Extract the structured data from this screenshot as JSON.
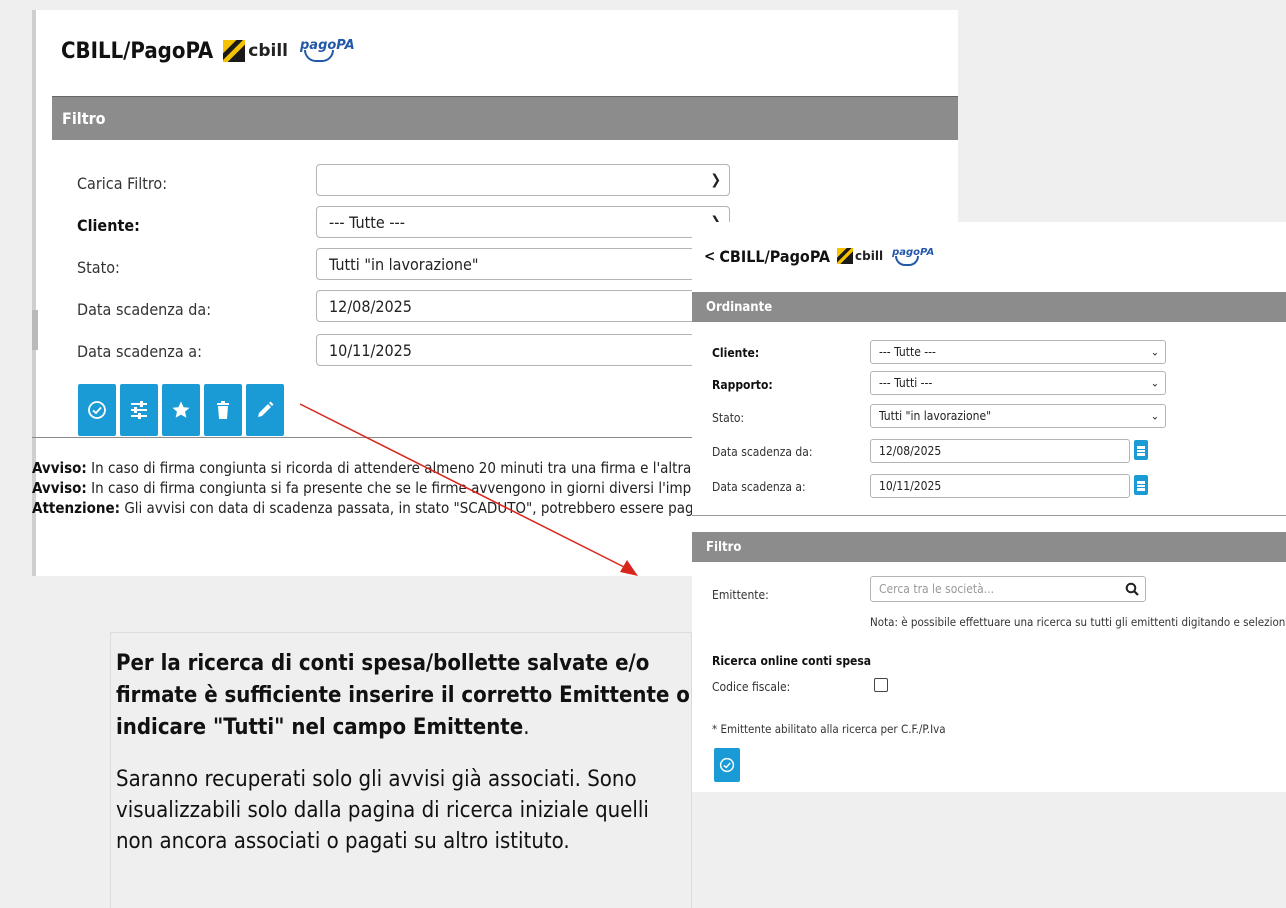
{
  "colors": {
    "accent": "#1b9bd6",
    "section_bar": "#8c8c8c",
    "arrow": "#d9261c"
  },
  "panel1": {
    "title": "CBILL/PagoPA",
    "logo_cbill": "cbill",
    "logo_pagopa": "pagoPA",
    "section_title": "Filtro",
    "fields": {
      "carica_filtro_label": "Carica Filtro:",
      "carica_filtro_value": "",
      "cliente_label": "Cliente:",
      "cliente_value": "--- Tutte ---",
      "stato_label": "Stato:",
      "stato_value": "Tutti \"in lavorazione\"",
      "data_da_label": "Data scadenza da:",
      "data_da_value": "12/08/2025",
      "data_a_label": "Data scadenza a:",
      "data_a_value": "10/11/2025"
    },
    "toolbar_icons": [
      "check-circle-icon",
      "sliders-icon",
      "star-icon",
      "trash-icon",
      "pencil-icon"
    ],
    "notes": [
      {
        "bold": "Avviso:",
        "text": " In caso di firma congiunta si ricorda di attendere almeno 20 minuti tra una firma e l'altra, in"
      },
      {
        "bold": "Avviso:",
        "text": " In caso di firma congiunta si fa presente che se le firme avvengono in giorni diversi l'importo"
      },
      {
        "bold": "Attenzione:",
        "text": " Gli avvisi con data di scadenza passata, in stato \"SCADUTO\", potrebbero essere pagabili"
      }
    ]
  },
  "info": {
    "strong_a": "Per la ricerca di conti spesa/bollette salvate e/o firmate è sufficiente inserire il corretto Emittente o indicare \"Tutti\" nel campo Emittente",
    "strong_end": ".",
    "normal": "Saranno recuperati solo gli avvisi già associati. Sono visualizzabili solo dalla pagina di ricerca iniziale quelli non ancora associati o pagati su altro istituto."
  },
  "panel2": {
    "back_glyph": "<",
    "title": "CBILL/PagoPA",
    "logo_cbill": "cbill",
    "logo_pagopa": "pagoPA",
    "ordinante_title": "Ordinante",
    "fields": {
      "cliente_label": "Cliente:",
      "cliente_value": "--- Tutte ---",
      "rapporto_label": "Rapporto:",
      "rapporto_value": "--- Tutti ---",
      "stato_label": "Stato:",
      "stato_value": "Tutti \"in lavorazione\"",
      "data_da_label": "Data scadenza da:",
      "data_da_value": "12/08/2025",
      "data_a_label": "Data scadenza a:",
      "data_a_value": "10/11/2025"
    },
    "filtro_title": "Filtro",
    "emittente_label": "Emittente:",
    "emittente_placeholder": "Cerca tra le società...",
    "emittente_note": "Nota: è possibile effettuare una ricerca su tutti gli emittenti digitando e selezionando \"Tutti\"",
    "ricerca_title": "Ricerca online conti spesa",
    "codice_fiscale_label": "Codice fiscale:",
    "footnote": "* Emittente abilitato alla ricerca per C.F./P.Iva"
  }
}
